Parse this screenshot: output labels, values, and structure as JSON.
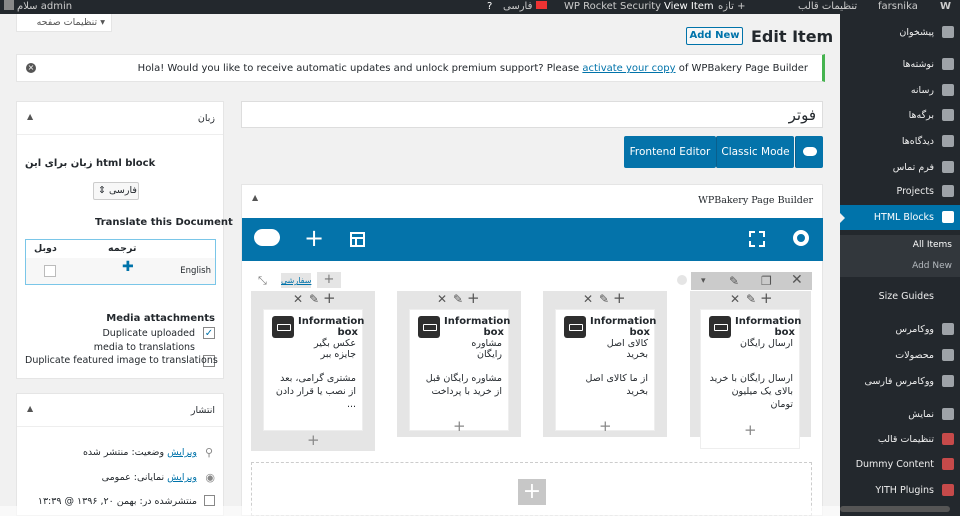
{
  "adminbar": {
    "user": "سلام admin",
    "lang": "فارسی",
    "rocket": "WP Rocket",
    "security": "Security",
    "view": "View Item",
    "new": "تازه",
    "theme": "تنظیمات قالب",
    "site": "farsnika"
  },
  "screen_options": "تنظیمات صفحه",
  "page_title": "Edit Item",
  "add_new": "Add New",
  "notice": {
    "before": "Hola! Would you like to receive automatic updates and unlock premium support? Please ",
    "link": "activate your copy",
    "after": " of WPBakery Page Builder"
  },
  "post_title": "فوتر",
  "editor_tabs": {
    "frontend": "Frontend Editor",
    "classic": "Classic Mode"
  },
  "builder": {
    "title": "WPBakery Page Builder",
    "row_tag": "سفارشی"
  },
  "elements": [
    {
      "title": "Information box",
      "subtitle": "ارسال رایگان",
      "body": "ارسال رایگان با خرید بالای یک میلیون تومان"
    },
    {
      "title": "Information box",
      "subtitle": "کالای اصل بخرید",
      "body": "از ما کالای اصل بخرید"
    },
    {
      "title": "Information box",
      "subtitle": "مشاوره رایگان",
      "body": "مشاوره رایگان قبل از خرید با پرداخت"
    },
    {
      "title": "Information box",
      "subtitle": "عکس بگیر جایزه ببر",
      "body": "مشتری گرامی، بعد از نصب یا قرار دادن ..."
    }
  ],
  "lang_box": {
    "title": "زبان",
    "heading": "زبان برای این html block",
    "select": "فارسی",
    "translate_title": "Translate this Document",
    "col_translation": "ترجمه",
    "col_duplicate": "دوبل",
    "lang_name": "English",
    "media_title": "Media attachments",
    "dup_media": "Duplicate uploaded media to translations",
    "dup_featured": "Duplicate featured image to translations"
  },
  "publish_box": {
    "title": "انتشار",
    "status_label": "وضعیت: منتشر شده",
    "visibility_label": "نمایانی: عمومی",
    "edit": "ویرایش",
    "published_on": "منتشرشده در: بهمن ۲۰, ۱۳۹۶ @ ۱۳:۳۹"
  },
  "menu": [
    {
      "label": "پیشخوان"
    },
    {
      "label": "نوشته‌ها"
    },
    {
      "label": "رسانه"
    },
    {
      "label": "برگه‌ها"
    },
    {
      "label": "دیدگاه‌ها"
    },
    {
      "label": "فرم تماس"
    },
    {
      "label": "Projects"
    },
    {
      "label": "HTML Blocks"
    }
  ],
  "submenu": [
    {
      "label": "All Items"
    },
    {
      "label": "Add New"
    }
  ],
  "menu2": [
    {
      "label": "Size Guides"
    },
    {
      "label": "ووکامرس"
    },
    {
      "label": "محصولات"
    },
    {
      "label": "ووکامرس فارسی"
    },
    {
      "label": "نمایش"
    },
    {
      "label": "تنظیمات قالب"
    },
    {
      "label": "Dummy Content"
    },
    {
      "label": "YITH Plugins"
    }
  ],
  "colors": {
    "accent": "#0073aa",
    "sidebar": "#23282d",
    "builder": "#0473aa"
  }
}
